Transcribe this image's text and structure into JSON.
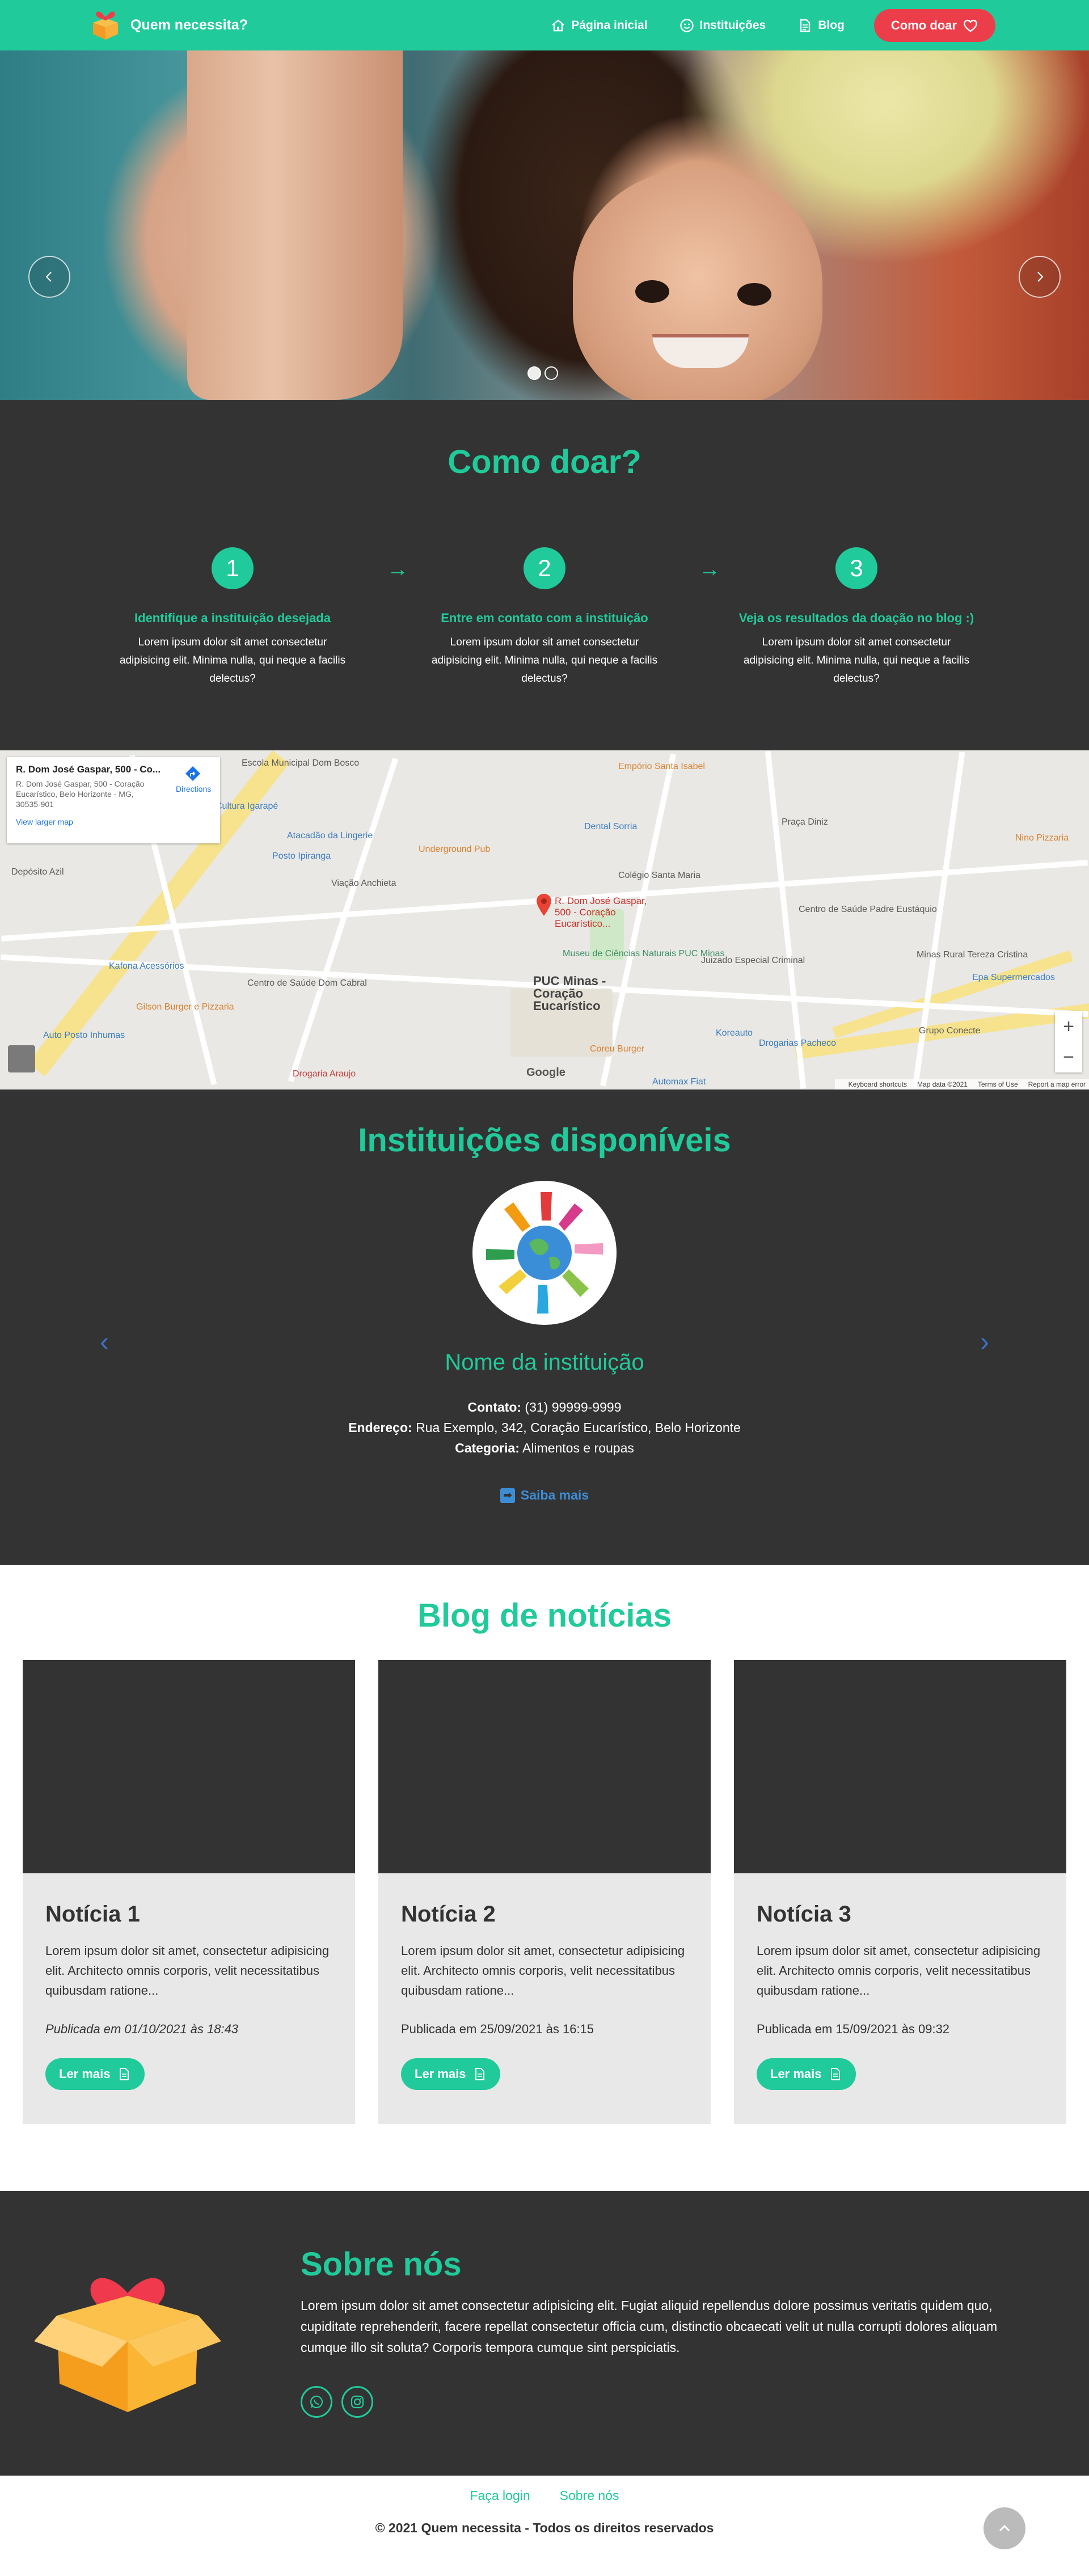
{
  "navbar": {
    "brand": "Quem necessita?",
    "links": [
      {
        "label": "Página inicial",
        "icon": "home-icon"
      },
      {
        "label": "Instituições",
        "icon": "smile-icon"
      },
      {
        "label": "Blog",
        "icon": "document-icon"
      }
    ],
    "donate_label": "Como doar",
    "colors": {
      "accent": "#21ca9b",
      "donate": "#ec3e4a"
    }
  },
  "hero": {
    "slides": 2,
    "active_slide": 1
  },
  "how_to": {
    "title": "Como doar?",
    "steps": [
      {
        "number": "1",
        "title": "Identifique a instituição desejada",
        "text": "Lorem ipsum dolor sit amet consectetur adipisicing elit. Minima nulla, qui neque a facilis delectus?"
      },
      {
        "number": "2",
        "title": "Entre em contato com a instituição",
        "text": "Lorem ipsum dolor sit amet consectetur adipisicing elit. Minima nulla, qui neque a facilis delectus?"
      },
      {
        "number": "3",
        "title": "Veja os resultados da doação no blog :)",
        "text": "Lorem ipsum dolor sit amet consectetur adipisicing elit. Minima nulla, qui neque a facilis delectus?"
      }
    ]
  },
  "map": {
    "card_title": "R. Dom José Gaspar, 500 - Co...",
    "card_address": "R. Dom José Gaspar, 500 - Coração Eucarístico, Belo Horizonte - MG, 30535-901",
    "directions_label": "Directions",
    "larger_map_label": "View larger map",
    "marker_label": "R. Dom José Gaspar, 500 - Coração Eucarístico...",
    "places": {
      "escola": "Escola Municipal Dom Bosco",
      "emporio": "Empório Santa Isabel",
      "dental": "Dental Sorria",
      "praca": "Praça Diniz",
      "nino": "Nino Pizzaria",
      "cultura": "Cultura Igarapé",
      "alacadao": "Atacadão da Lingerie",
      "posto_ipiranga": "Posto Ipiranga",
      "underground": "Underground Pub",
      "anchieta": "Viação Anchieta",
      "colegio": "Colégio Santa Maria",
      "saude_padre": "Centro de Saúde Padre Eustáquio",
      "deposito": "Depósito Azil",
      "museu": "Museu de Ciências Naturais PUC Minas",
      "juizado": "Juizado Especial Criminal",
      "minas_rural": "Minas Rural Tereza Cristina",
      "kafona": "Kafona Acessórios",
      "saude_cabral": "Centro de Saúde Dom Cabral",
      "puc": "PUC Minas - Coração Eucarístico",
      "epa": "Epa Supermercados",
      "gilson": "Gilson Burger e Pizzaria",
      "koreauto": "Koreauto",
      "grupo": "Grupo Conecte",
      "posto_inhumas": "Auto Posto Inhumas",
      "coreu": "Coreu Burger",
      "pacheco": "Drogarias Pacheco",
      "araujo": "Drogaria Araujo",
      "automax": "Automax Fiat"
    },
    "google": "Google",
    "footer": [
      "Keyboard shortcuts",
      "Map data ©2021",
      "Terms of Use",
      "Report a map error"
    ]
  },
  "institutions": {
    "title": "Instituições disponíveis",
    "name": "Nome da instituição",
    "contact_label": "Contato:",
    "contact_value": "(31) 99999-9999",
    "address_label": "Endereço:",
    "address_value": "Rua Exemplo, 342, Coração Eucarístico, Belo Horizonte",
    "category_label": "Categoria:",
    "category_value": "Alimentos e roupas",
    "more_label": "Saiba mais"
  },
  "blog": {
    "title": "Blog de notícias",
    "posts": [
      {
        "title": "Notícia 1",
        "text": "Lorem ipsum dolor sit amet, consectetur adipisicing elit. Architecto omnis corporis, velit necessitatibus quibusdam ratione...",
        "date": "Publicada em 01/10/2021 às 18:43",
        "button": "Ler mais"
      },
      {
        "title": "Notícia 2",
        "text": "Lorem ipsum dolor sit amet, consectetur adipisicing elit. Architecto omnis corporis, velit necessitatibus quibusdam ratione...",
        "date": "Publicada em 25/09/2021 às 16:15",
        "button": "Ler mais"
      },
      {
        "title": "Notícia 3",
        "text": "Lorem ipsum dolor sit amet, consectetur adipisicing elit. Architecto omnis corporis, velit necessitatibus quibusdam ratione...",
        "date": "Publicada em 15/09/2021 às 09:32",
        "button": "Ler mais"
      }
    ]
  },
  "about": {
    "title": "Sobre nós",
    "text": "Lorem ipsum dolor sit amet consectetur adipisicing elit. Fugiat aliquid repellendus dolore possimus veritatis quidem quo, cupiditate reprehenderit, facere repellat consectetur officia cum, distinctio obcaecati velit ut nulla corrupti dolores aliquam cumque illo sit soluta? Corporis tempora cumque sint perspiciatis."
  },
  "footer": {
    "links": [
      "Faça login",
      "Sobre nós"
    ],
    "copyright": "© 2021 Quem necessita - Todos os direitos reservados"
  }
}
